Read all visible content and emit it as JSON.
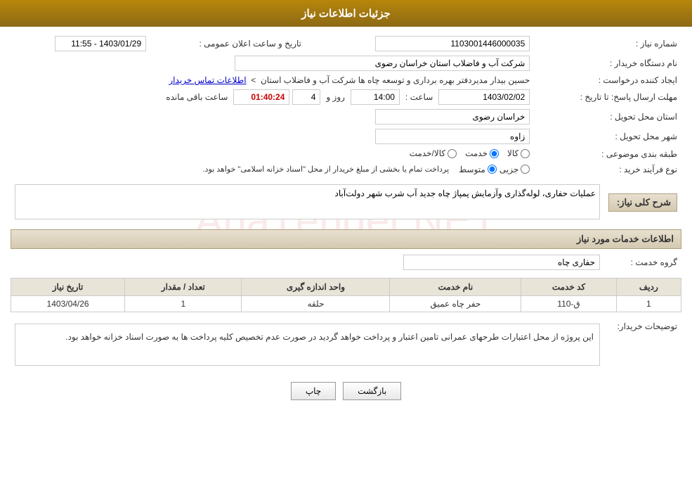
{
  "header": {
    "title": "جزئیات اطلاعات نیاز"
  },
  "fields": {
    "shomare_niaz_label": "شماره نیاز :",
    "shomare_niaz_value": "1103001446000035",
    "nam_dastgah_label": "نام دستگاه خریدار :",
    "nam_dastgah_value": "شرکت آب و فاضلاب استان خراسان رضوی",
    "ejad_label": "ایجاد کننده درخواست :",
    "ejad_value": "حسین  بیدار مدیردفتر بهره برداری و توسعه چاه ها شرکت آب و فاضلاب استان",
    "ejad_link": "اطلاعات تماس خریدار",
    "mohlat_label": "مهلت ارسال پاسخ: تا تاریخ :",
    "date_value": "1403/02/02",
    "saat_label": "ساعت :",
    "saat_value": "14:00",
    "rooz_label": "روز و",
    "rooz_value": "4",
    "baqi_label": "ساعت باقی مانده",
    "baqi_value": "01:40:24",
    "ostan_label": "استان محل تحویل :",
    "ostan_value": "خراسان رضوی",
    "shahr_label": "شهر محل تحویل :",
    "shahr_value": "زاوه",
    "tabagheh_label": "طبقه بندی موضوعی :",
    "tabagheh_options": [
      "کالا",
      "خدمت",
      "کالا/خدمت"
    ],
    "tabagheh_selected": "خدمت",
    "nooe_label": "نوع فرآیند خرید :",
    "nooe_options": [
      "جزیی",
      "متوسط"
    ],
    "nooe_note": "پرداخت تمام یا بخشی از مبلغ خریدار از محل \"اسناد خزانه اسلامی\" خواهد بود.",
    "sharh_label": "شرح کلی نیاز:",
    "sharh_value": "عملیات حفاری، لوله‌گذاری وآزمایش پمپاژ چاه جدید آب شرب شهر دولت‌آباد",
    "khadamat_header": "اطلاعات خدمات مورد نیاز",
    "gorooh_label": "گروه خدمت :",
    "gorooh_value": "حفاری چاه",
    "table_headers": [
      "ردیف",
      "کد خدمت",
      "نام خدمت",
      "واحد اندازه گیری",
      "تعداد / مقدار",
      "تاریخ نیاز"
    ],
    "table_rows": [
      {
        "radif": "1",
        "kod": "ق-110",
        "nam": "حفر چاه عمیق",
        "vahed": "حلقه",
        "tedad": "1",
        "tarikh": "1403/04/26"
      }
    ],
    "towzih_label": "توضیحات خریدار:",
    "towzih_value": "این پروژه از محل اعتبارات طرحهای عمرانی تامین اعتبار و پرداخت خواهد گردید در صورت عدم تخصیص کلیه پرداخت ها به صورت اسناد خزانه خواهد بود.",
    "taarikh_ealaan_label": "تاریخ و ساعت اعلان عمومی :",
    "taarikh_ealaan_value": "1403/01/29 - 11:55"
  },
  "buttons": {
    "print_label": "چاپ",
    "back_label": "بازگشت"
  }
}
